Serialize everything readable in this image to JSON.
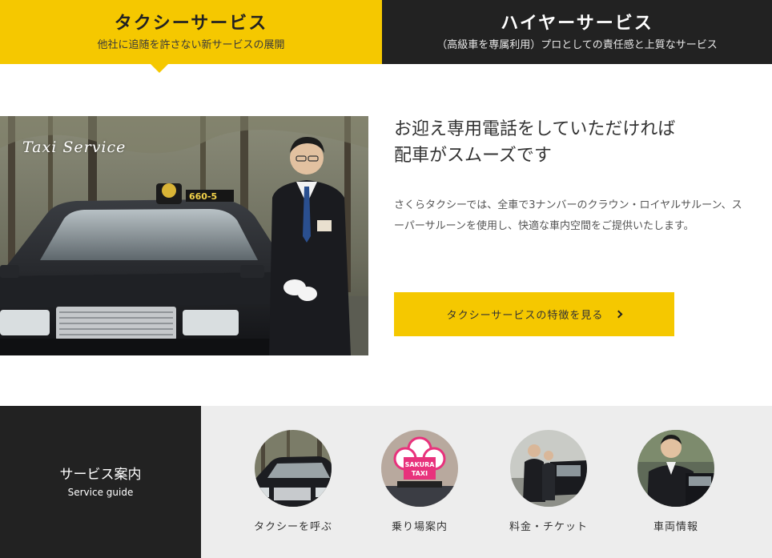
{
  "tabs": {
    "taxi": {
      "title": "タクシーサービス",
      "subtitle": "他社に追随を許さない新サービスの展開"
    },
    "hire": {
      "title": "ハイヤーサービス",
      "subtitle": "（高級車を専属利用）プロとしての責任感と上質なサービス"
    }
  },
  "hero": {
    "caption": "Taxi Service",
    "roof_sign_number": "660-5",
    "heading_line1": "お迎え専用電話をしていただければ",
    "heading_line2": "配車がスムーズです",
    "desc_line1": "さくらタクシーでは、全車で3ナンバーのクラウン・ロイヤルサルーン、ス",
    "desc_line2": "ーパーサルーンを使用し、快適な車内空間をご提供いたします。",
    "cta_label": "タクシーサービスの特徴を見る"
  },
  "guide": {
    "title": "サービス案内",
    "subtitle": "Service guide",
    "items": [
      {
        "label": "タクシーを呼ぶ"
      },
      {
        "label": "乗り場案内",
        "sign_line1": "SAKURA",
        "sign_line2": "TAXI"
      },
      {
        "label": "料金・チケット"
      },
      {
        "label": "車両情報"
      }
    ]
  },
  "colors": {
    "accent_yellow": "#f5c800",
    "dark": "#222222",
    "light_gray": "#ededed",
    "sakura_pink": "#e8327c"
  }
}
